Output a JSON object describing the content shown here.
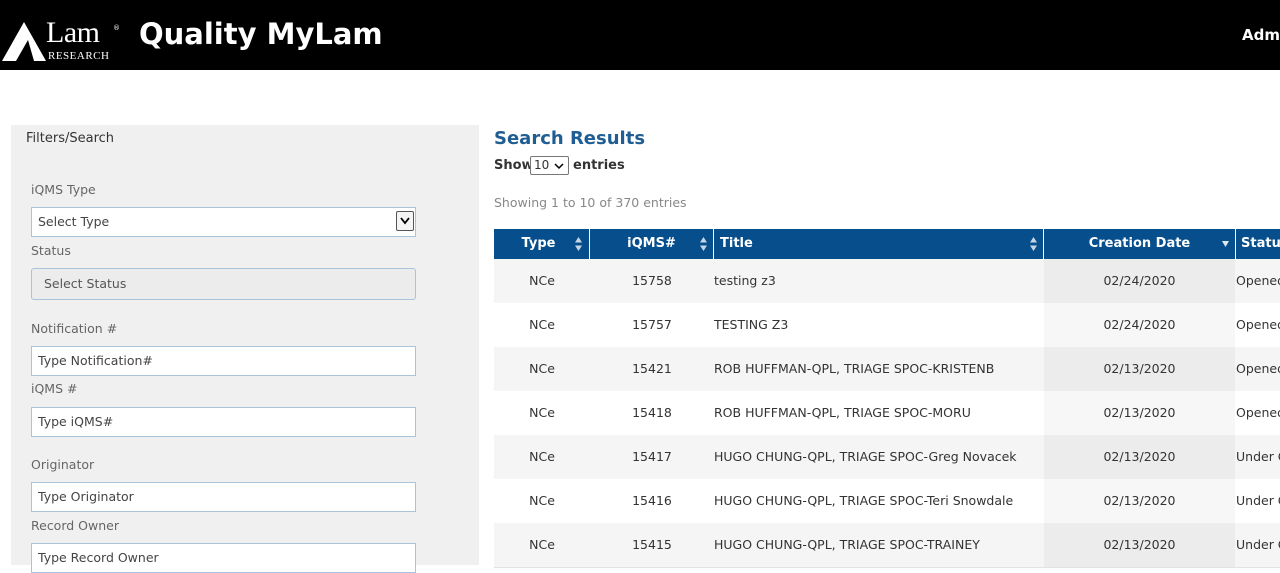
{
  "header": {
    "logo_word": "Lam",
    "logo_tm": "®",
    "logo_sub": "RESEARCH",
    "app_title": "Quality MyLam",
    "admin_label": "Admi"
  },
  "filters": {
    "title": "Filters/Search",
    "iqms_type": {
      "label": "iQMS Type",
      "value": "Select Type"
    },
    "status": {
      "label": "Status",
      "placeholder": "Select Status"
    },
    "notification": {
      "label": "Notification #",
      "placeholder": "Type Notification#"
    },
    "iqms_number": {
      "label": "iQMS #",
      "placeholder": "Type iQMS#"
    },
    "originator": {
      "label": "Originator",
      "placeholder": "Type Originator"
    },
    "record_owner": {
      "label": "Record Owner",
      "placeholder": "Type Record Owner"
    }
  },
  "results": {
    "title": "Search Results",
    "show_label": "Show",
    "entries_value": "10",
    "entries_label": "entries",
    "showing_text": "Showing 1 to 10 of 370 entries",
    "columns": [
      "Type",
      "iQMS#",
      "Title",
      "Creation Date",
      "Status"
    ],
    "sorted_column": "Creation Date",
    "sort_direction": "descending",
    "rows": [
      {
        "type": "NCe",
        "iqms": "15758",
        "title": "testing z3",
        "date": "02/24/2020",
        "status": "Opened"
      },
      {
        "type": "NCe",
        "iqms": "15757",
        "title": "TESTING Z3",
        "date": "02/24/2020",
        "status": "Opened"
      },
      {
        "type": "NCe",
        "iqms": "15421",
        "title": "ROB HUFFMAN-QPL, TRIAGE SPOC-KRISTENB",
        "date": "02/13/2020",
        "status": "Opened"
      },
      {
        "type": "NCe",
        "iqms": "15418",
        "title": "ROB HUFFMAN-QPL, TRIAGE SPOC-MORU",
        "date": "02/13/2020",
        "status": "Opened"
      },
      {
        "type": "NCe",
        "iqms": "15417",
        "title": "HUGO CHUNG-QPL, TRIAGE SPOC-Greg Novacek",
        "date": "02/13/2020",
        "status": "Under C"
      },
      {
        "type": "NCe",
        "iqms": "15416",
        "title": "HUGO CHUNG-QPL, TRIAGE SPOC-Teri Snowdale",
        "date": "02/13/2020",
        "status": "Under C"
      },
      {
        "type": "NCe",
        "iqms": "15415",
        "title": "HUGO CHUNG-QPL, TRIAGE SPOC-TRAINEY",
        "date": "02/13/2020",
        "status": "Under C"
      }
    ]
  },
  "colors": {
    "header_bg": "#000000",
    "table_header_bg": "#064f8c",
    "results_title": "#1f5d93",
    "filter_panel_bg": "#f0f0f0"
  }
}
